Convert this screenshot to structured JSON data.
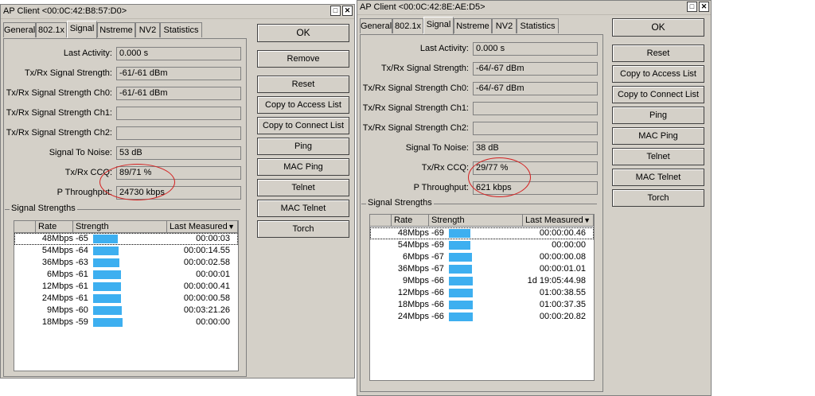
{
  "windows": [
    {
      "title": "AP Client <00:0C:42:B8:57:D0>",
      "tabs": [
        "General",
        "802.1x",
        "Signal",
        "Nstreme",
        "NV2",
        "Statistics"
      ],
      "active_tab": "Signal",
      "fields": [
        {
          "label": "Last Activity:",
          "value": "0.000 s"
        },
        {
          "label": "Tx/Rx Signal Strength:",
          "value": "-61/-61 dBm"
        },
        {
          "label": "Tx/Rx Signal Strength Ch0:",
          "value": "-61/-61 dBm"
        },
        {
          "label": "Tx/Rx Signal Strength Ch1:",
          "value": ""
        },
        {
          "label": "Tx/Rx Signal Strength Ch2:",
          "value": ""
        },
        {
          "label": "Signal To Noise:",
          "value": "53 dB"
        },
        {
          "label": "Tx/Rx CCQ:",
          "value": "89/71 %"
        },
        {
          "label": "P Throughput:",
          "value": "24730 kbps"
        }
      ],
      "group_label": "Signal Strengths",
      "columns": [
        "Rate",
        "Strength",
        "Last Measured"
      ],
      "rows": [
        {
          "rate": "48Mbps",
          "strength": "-65",
          "last": "00:00:03",
          "level": 0.65
        },
        {
          "rate": "54Mbps",
          "strength": "-64",
          "last": "00:00:14.55",
          "level": 0.67
        },
        {
          "rate": "36Mbps",
          "strength": "-63",
          "last": "00:00:02.58",
          "level": 0.69
        },
        {
          "rate": "6Mbps",
          "strength": "-61",
          "last": "00:00:01",
          "level": 0.73
        },
        {
          "rate": "12Mbps",
          "strength": "-61",
          "last": "00:00:00.41",
          "level": 0.73
        },
        {
          "rate": "24Mbps",
          "strength": "-61",
          "last": "00:00:00.58",
          "level": 0.73
        },
        {
          "rate": "9Mbps",
          "strength": "-60",
          "last": "00:03:21.26",
          "level": 0.75
        },
        {
          "rate": "18Mbps",
          "strength": "-59",
          "last": "00:00:00",
          "level": 0.77
        }
      ],
      "buttons": [
        "OK",
        "Remove",
        "Reset",
        "Copy to Access List",
        "Copy to Connect List",
        "Ping",
        "MAC Ping",
        "Telnet",
        "MAC Telnet",
        "Torch"
      ]
    },
    {
      "title": "AP Client <00:0C:42:8E:AE:D5>",
      "tabs": [
        "General",
        "802.1x",
        "Signal",
        "Nstreme",
        "NV2",
        "Statistics"
      ],
      "active_tab": "Signal",
      "fields": [
        {
          "label": "Last Activity:",
          "value": "0.000 s"
        },
        {
          "label": "Tx/Rx Signal Strength:",
          "value": "-64/-67 dBm"
        },
        {
          "label": "Tx/Rx Signal Strength Ch0:",
          "value": "-64/-67 dBm"
        },
        {
          "label": "Tx/Rx Signal Strength Ch1:",
          "value": ""
        },
        {
          "label": "Tx/Rx Signal Strength Ch2:",
          "value": ""
        },
        {
          "label": "Signal To Noise:",
          "value": "38 dB"
        },
        {
          "label": "Tx/Rx CCQ:",
          "value": "29/77 %"
        },
        {
          "label": "P Throughput:",
          "value": "621 kbps"
        }
      ],
      "group_label": "Signal Strengths",
      "columns": [
        "Rate",
        "Strength",
        "Last Measured"
      ],
      "rows": [
        {
          "rate": "48Mbps",
          "strength": "-69",
          "last": "00:00:00.46",
          "level": 0.57
        },
        {
          "rate": "54Mbps",
          "strength": "-69",
          "last": "00:00:00",
          "level": 0.57
        },
        {
          "rate": "6Mbps",
          "strength": "-67",
          "last": "00:00:00.08",
          "level": 0.61
        },
        {
          "rate": "36Mbps",
          "strength": "-67",
          "last": "00:00:01.01",
          "level": 0.61
        },
        {
          "rate": "9Mbps",
          "strength": "-66",
          "last": "1d 19:05:44.98",
          "level": 0.63
        },
        {
          "rate": "12Mbps",
          "strength": "-66",
          "last": "01:00:38.55",
          "level": 0.63
        },
        {
          "rate": "18Mbps",
          "strength": "-66",
          "last": "01:00:37.35",
          "level": 0.63
        },
        {
          "rate": "24Mbps",
          "strength": "-66",
          "last": "00:00:20.82",
          "level": 0.63
        }
      ],
      "buttons": [
        "OK",
        "Reset",
        "Copy to Access List",
        "Copy to Connect List",
        "Ping",
        "MAC Ping",
        "Telnet",
        "MAC Telnet",
        "Torch"
      ]
    }
  ],
  "colors": {
    "bar": "#3daff0",
    "annotation": "#d42020",
    "window_bg": "#d4d0c8"
  },
  "icons": {
    "maximize": "maximize-icon",
    "close": "close-icon",
    "sort": "sort-down-icon"
  }
}
